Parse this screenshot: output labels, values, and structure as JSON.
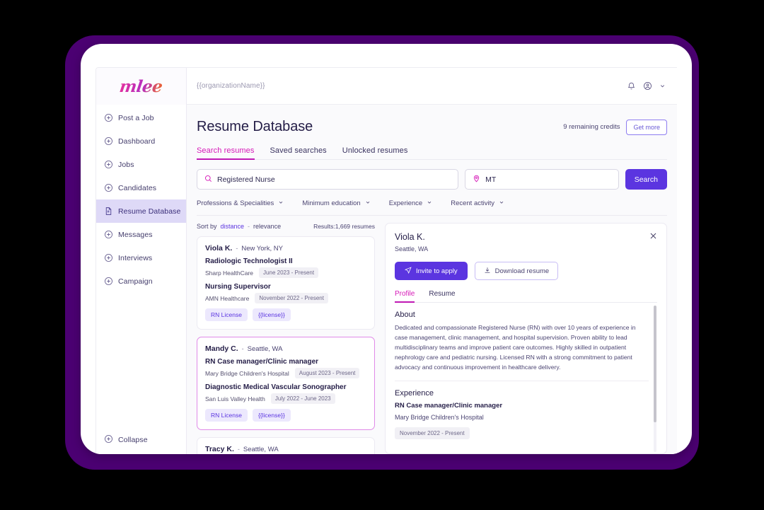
{
  "sidebar": {
    "logo": "mlee",
    "items": [
      {
        "label": "Post a Job",
        "icon": "plus-circle-icon",
        "active": false
      },
      {
        "label": "Dashboard",
        "icon": "plus-circle-icon",
        "active": false
      },
      {
        "label": "Jobs",
        "icon": "plus-circle-icon",
        "active": false
      },
      {
        "label": "Candidates",
        "icon": "plus-circle-icon",
        "active": false
      },
      {
        "label": "Resume Database",
        "icon": "document-icon",
        "active": true
      },
      {
        "label": "Messages",
        "icon": "plus-circle-icon",
        "active": false
      },
      {
        "label": "Interviews",
        "icon": "plus-circle-icon",
        "active": false
      },
      {
        "label": "Campaign",
        "icon": "plus-circle-icon",
        "active": false
      }
    ],
    "collapse_label": "Collapse",
    "collapse_icon": "plus-circle-icon"
  },
  "topbar": {
    "organization": "{{organizationName}}",
    "bell_icon": "bell-icon",
    "avatar_icon": "user-circle-icon",
    "chevron_icon": "chevron-down-icon"
  },
  "page": {
    "title": "Resume Database",
    "credits_text": "9 remaining credits",
    "get_more_label": "Get more"
  },
  "tabs": [
    {
      "label": "Search resumes",
      "active": true
    },
    {
      "label": "Saved searches",
      "active": false
    },
    {
      "label": "Unlocked resumes",
      "active": false
    }
  ],
  "search": {
    "keyword_value": "Registered Nurse",
    "keyword_placeholder": "Registered Nurse",
    "keyword_icon": "search-icon",
    "location_value": "MT",
    "location_placeholder": "MT",
    "location_icon": "map-pin-icon",
    "button_label": "Search"
  },
  "filters": [
    {
      "label": "Professions & Specialities",
      "icon": "chevron-down-icon"
    },
    {
      "label": "Minimum education",
      "icon": "chevron-down-icon"
    },
    {
      "label": "Experience",
      "icon": "chevron-down-icon"
    },
    {
      "label": "Recent activity",
      "icon": "chevron-down-icon"
    }
  ],
  "results": {
    "sort_label": "Sort by",
    "sort_distance": "distance",
    "sort_separator": "-",
    "sort_relevance": "relevance",
    "count_text": "Results:1,669 resumes",
    "cards": [
      {
        "name": "Viola K.",
        "dash": "-",
        "location": "New York, NY",
        "selected": false,
        "jobs": [
          {
            "title": "Radiologic Technologist II",
            "company": "Sharp HealthCare",
            "date": "June 2023 - Present"
          },
          {
            "title": "Nursing Supervisor",
            "company": "AMN Healthcare",
            "date": "November 2022 - Present"
          }
        ],
        "tags": [
          "RN License",
          "{{license}}"
        ]
      },
      {
        "name": "Mandy C.",
        "dash": "-",
        "location": "Seattle, WA",
        "selected": true,
        "jobs": [
          {
            "title": "RN Case manager/Clinic manager",
            "company": "Mary Bridge Children's Hospital",
            "date": "August 2023 - Present"
          },
          {
            "title": "Diagnostic Medical Vascular Sonographer",
            "company": "San Luis Valley Health",
            "date": "July 2022 - June 2023"
          }
        ],
        "tags": [
          "RN License",
          "{{license}}"
        ]
      },
      {
        "name": "Tracy K.",
        "dash": "-",
        "location": "Seattle, WA",
        "selected": false,
        "jobs": [],
        "tags": []
      }
    ]
  },
  "detail": {
    "name": "Viola K.",
    "location": "Seattle, WA",
    "close_icon": "close-icon",
    "invite_label": "Invite to apply",
    "invite_icon": "send-icon",
    "download_label": "Download resume",
    "download_icon": "download-icon",
    "tabs": [
      {
        "label": "Profile",
        "active": true
      },
      {
        "label": "Resume",
        "active": false
      }
    ],
    "about_title": "About",
    "about_text": "Dedicated and compassionate Registered Nurse (RN) with over 10 years of experience in case management, clinic management, and hospital supervision. Proven ability to lead multidisciplinary teams and improve patient care outcomes. Highly skilled in outpatient nephrology care and pediatric nursing. Licensed RN with a strong commitment to patient advocacy and continuous improvement in healthcare delivery.",
    "experience_title": "Experience",
    "experience": [
      {
        "title": "RN Case manager/Clinic manager",
        "company": "Mary Bridge Children's Hospital",
        "date": "November 2022 - Present"
      }
    ]
  },
  "colors": {
    "accent_purple": "#5b35e0",
    "accent_magenta": "#c018b4",
    "frame_purple": "#4b0072",
    "sidebar_active": "#ded9f7"
  }
}
